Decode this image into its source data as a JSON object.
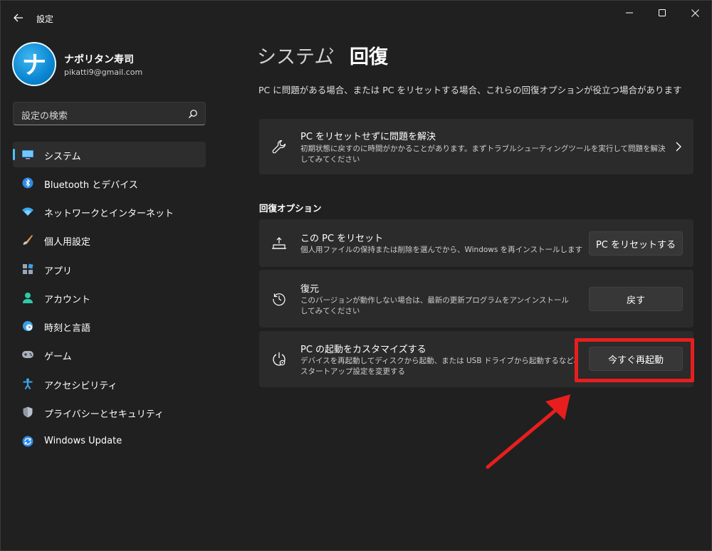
{
  "window": {
    "title": "設定",
    "icons": [
      "back-arrow-icon",
      "minimize-icon",
      "maximize-icon",
      "close-icon"
    ]
  },
  "profile": {
    "avatar_glyph": "ナ",
    "name": "ナポリタン寿司",
    "email": "pikatti9@gmail.com"
  },
  "search": {
    "placeholder": "設定の検索",
    "icon": "search-icon"
  },
  "sidebar": {
    "items": [
      {
        "label": "システム",
        "icon": "monitor-icon",
        "active": true
      },
      {
        "label": "Bluetooth とデバイス",
        "icon": "bluetooth-icon"
      },
      {
        "label": "ネットワークとインターネット",
        "icon": "wifi-icon"
      },
      {
        "label": "個人用設定",
        "icon": "brush-icon"
      },
      {
        "label": "アプリ",
        "icon": "apps-icon"
      },
      {
        "label": "アカウント",
        "icon": "person-icon"
      },
      {
        "label": "時刻と言語",
        "icon": "globe-clock-icon"
      },
      {
        "label": "ゲーム",
        "icon": "gamepad-icon"
      },
      {
        "label": "アクセシビリティ",
        "icon": "accessibility-icon"
      },
      {
        "label": "プライバシーとセキュリティ",
        "icon": "shield-icon"
      },
      {
        "label": "Windows Update",
        "icon": "update-icon"
      }
    ]
  },
  "main": {
    "breadcrumb": {
      "parent": "システム",
      "separator": "›",
      "current": "回復"
    },
    "description": "PC に問題がある場合、または PC をリセットする場合、これらの回復オプションが役立つ場合があります",
    "fix_card": {
      "title": "PC をリセットせずに問題を解決",
      "desc": "初期状態に戻すのに時間がかかることがあります。まずトラブルシューティングツールを実行して問題を解決してみてください",
      "icon": "wrench-icon"
    },
    "section_title": "回復オプション",
    "options": [
      {
        "title": "この PC をリセット",
        "desc": "個人用ファイルの保持または削除を選んでから、Windows を再インストールします",
        "button": "PC をリセットする",
        "icon": "reset-pc-icon"
      },
      {
        "title": "復元",
        "desc": "このバージョンが動作しない場合は、最新の更新プログラムをアンインストールしてみてください",
        "button": "戻す",
        "icon": "history-icon"
      },
      {
        "title": "PC の起動をカスタマイズする",
        "desc": "デバイスを再起動してディスクから起動、または USB ドライブから起動するなど、スタートアップ設定を変更する",
        "button": "今すぐ再起動",
        "icon": "startup-settings-icon"
      }
    ]
  },
  "colors": {
    "window_bg": "#202020",
    "card_bg": "#2b2b2b",
    "accent": "#4cc2ff",
    "annotation_red": "#e81e1e"
  }
}
